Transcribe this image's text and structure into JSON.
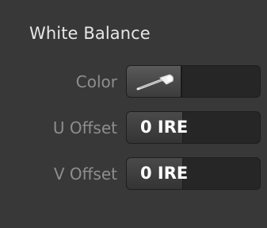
{
  "panel": {
    "title": "White Balance"
  },
  "rows": [
    {
      "label": "Color",
      "kind": "color",
      "icon": "eyedropper-icon",
      "swatch_color": ""
    },
    {
      "label": "U Offset",
      "kind": "numeric",
      "value": "0 IRE"
    },
    {
      "label": "V Offset",
      "kind": "numeric",
      "value": "0 IRE"
    }
  ],
  "colors": {
    "background": "#383838",
    "field_background": "#262626",
    "title_text": "#e6e6e6",
    "label_text": "#8e8e8e",
    "value_text": "#ffffff"
  }
}
